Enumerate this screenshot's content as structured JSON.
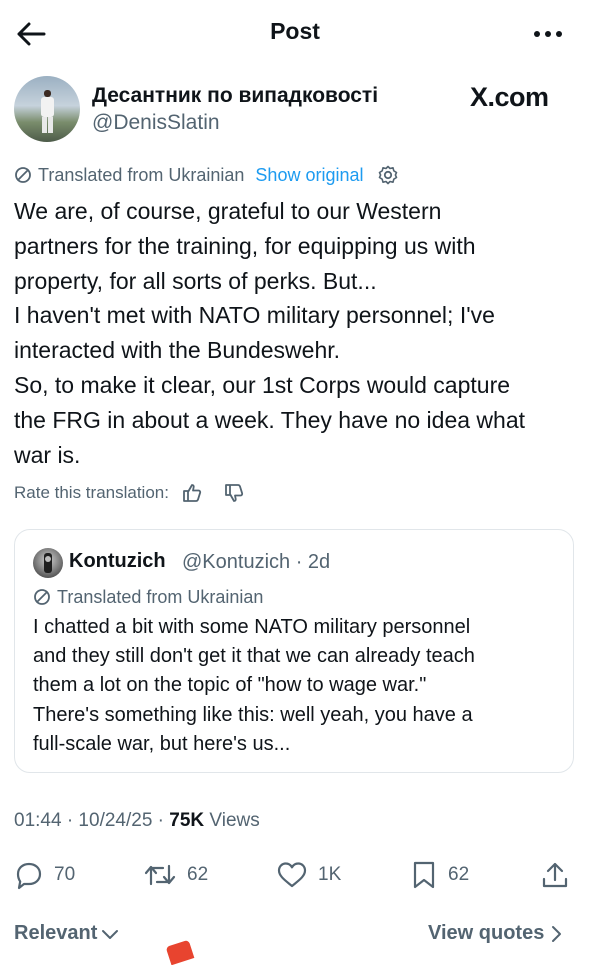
{
  "header": {
    "title": "Post"
  },
  "author": {
    "display_name": "Десантник по випадковості",
    "handle": "@DenisSlatin",
    "source_logo_text": "X.com"
  },
  "translation": {
    "label": "Translated from Ukrainian",
    "show_original": "Show original",
    "rate_label": "Rate this translation:"
  },
  "post_lines": [
    "We are, of course, grateful to our Western",
    "partners for the training, for equipping us with",
    "property, for all sorts of perks. But...",
    "I haven't met with NATO military personnel; I've",
    "interacted with the Bundeswehr.",
    "So, to make it clear, our 1st Corps would capture",
    "the FRG in about a week. They have no idea what",
    "war is."
  ],
  "quote": {
    "name": "Kontuzich",
    "handle_time": "@Kontuzich · 2d",
    "translated_label": "Translated from Ukrainian",
    "lines": [
      "I chatted a bit with some NATO military personnel",
      "and they still don't get it that we can already teach",
      "them a lot on the topic of \"how to wage war.\"",
      "There's something like this: well yeah, you have a",
      "full-scale war, but here's us..."
    ]
  },
  "meta": {
    "time_date": "01:44 · 10/24/25 · ",
    "views_count": "75K",
    "views_label": " Views"
  },
  "actions": {
    "replies": "70",
    "reposts": "62",
    "likes": "1K",
    "bookmarks": "62"
  },
  "footer": {
    "sort_label": "Relevant",
    "view_quotes": "View quotes"
  },
  "colors": {
    "accent": "#1d9bf0",
    "muted": "#536471",
    "text": "#0f1419"
  }
}
